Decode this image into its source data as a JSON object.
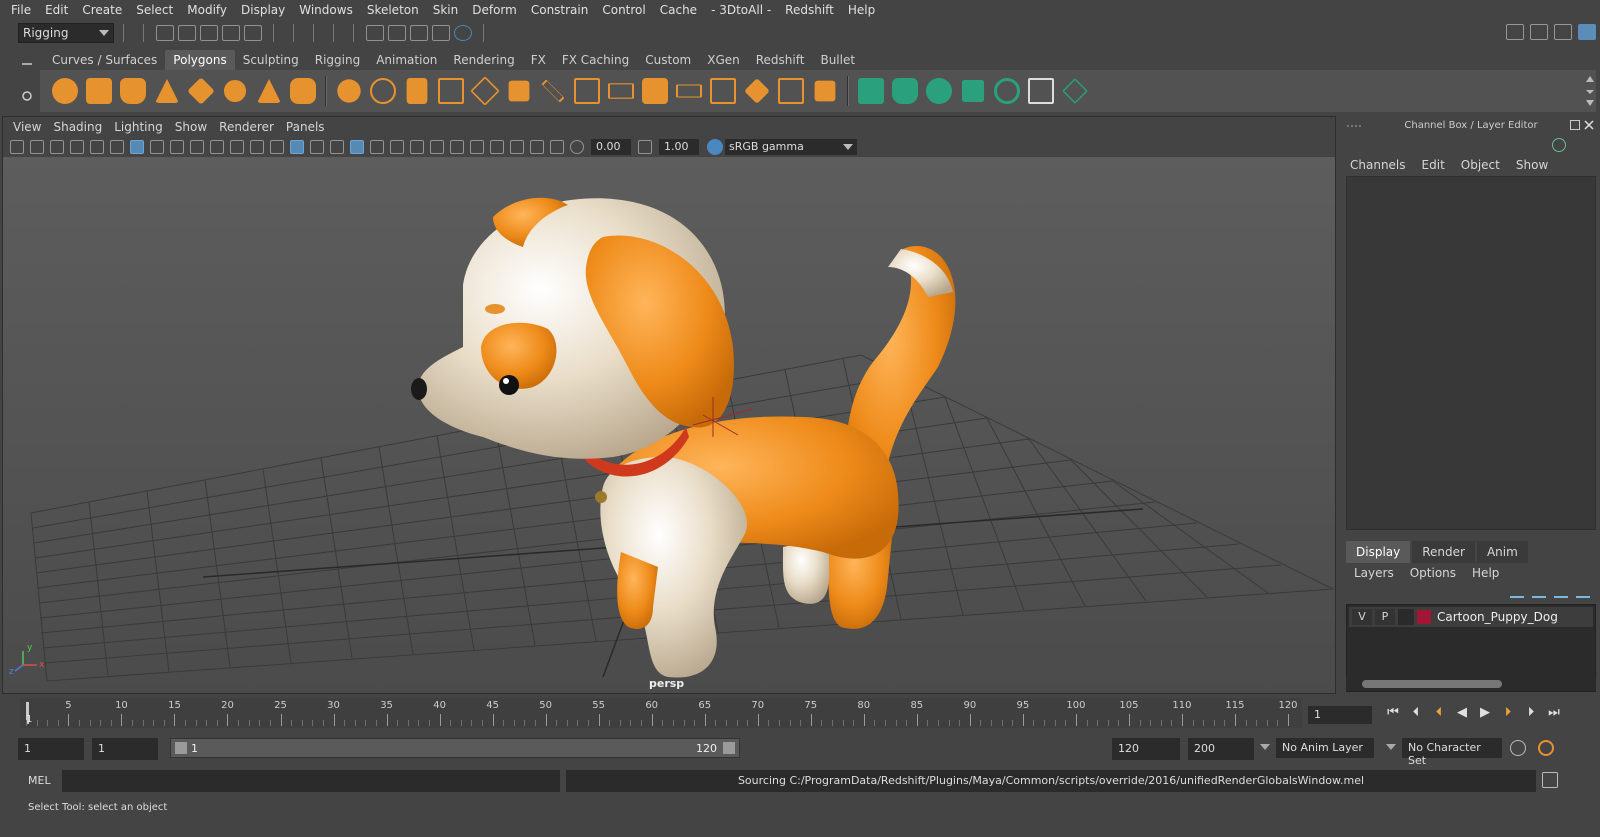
{
  "menubar": [
    "File",
    "Edit",
    "Create",
    "Select",
    "Modify",
    "Display",
    "Windows",
    "Skeleton",
    "Skin",
    "Deform",
    "Constrain",
    "Control",
    "Cache",
    "- 3DtoAll -",
    "Redshift",
    "Help"
  ],
  "statusline": {
    "mode": "Rigging"
  },
  "shelf": {
    "tabs": [
      "Curves / Surfaces",
      "Polygons",
      "Sculpting",
      "Rigging",
      "Animation",
      "Rendering",
      "FX",
      "FX Caching",
      "Custom",
      "XGen",
      "Redshift",
      "Bullet"
    ],
    "active_tab": "Polygons"
  },
  "viewport": {
    "menu": [
      "View",
      "Shading",
      "Lighting",
      "Show",
      "Renderer",
      "Panels"
    ],
    "exposure": "0.00",
    "gamma_value": "1.00",
    "color_space": "sRGB gamma",
    "camera_label": "persp",
    "axis_labels": {
      "x": "x",
      "y": "y",
      "z": "z"
    }
  },
  "channel_box": {
    "title": "Channel Box / Layer Editor",
    "menu": [
      "Channels",
      "Edit",
      "Object",
      "Show"
    ],
    "layer_tabs": [
      "Display",
      "Render",
      "Anim"
    ],
    "active_layer_tab": "Display",
    "layer_menu": [
      "Layers",
      "Options",
      "Help"
    ],
    "layers": [
      {
        "visible": "V",
        "playback": "P",
        "color": "#a31535",
        "name": "Cartoon_Puppy_Dog"
      }
    ]
  },
  "timeline": {
    "ticks": [
      "5",
      "10",
      "15",
      "20",
      "25",
      "30",
      "35",
      "40",
      "45",
      "50",
      "55",
      "60",
      "65",
      "70",
      "75",
      "80",
      "85",
      "90",
      "95",
      "100",
      "105",
      "110",
      "115",
      "120"
    ],
    "current_frame_marker": "1",
    "current_frame": "1"
  },
  "range": {
    "start_time": "1",
    "playback_start": "1",
    "slider_start": "1",
    "slider_end": "120",
    "playback_end": "120",
    "end_time": "200",
    "anim_layer": "No Anim Layer",
    "character_set": "No Character Set"
  },
  "commandline": {
    "label": "MEL",
    "result": "Sourcing C:/ProgramData/Redshift/Plugins/Maya/Common/scripts/override/2016/unifiedRenderGlobalsWindow.mel"
  },
  "helpline": "Select Tool: select an object",
  "colors": {
    "accent": "#e6922f",
    "layer_color": "#a31535",
    "active_blue": "#5689b3"
  }
}
